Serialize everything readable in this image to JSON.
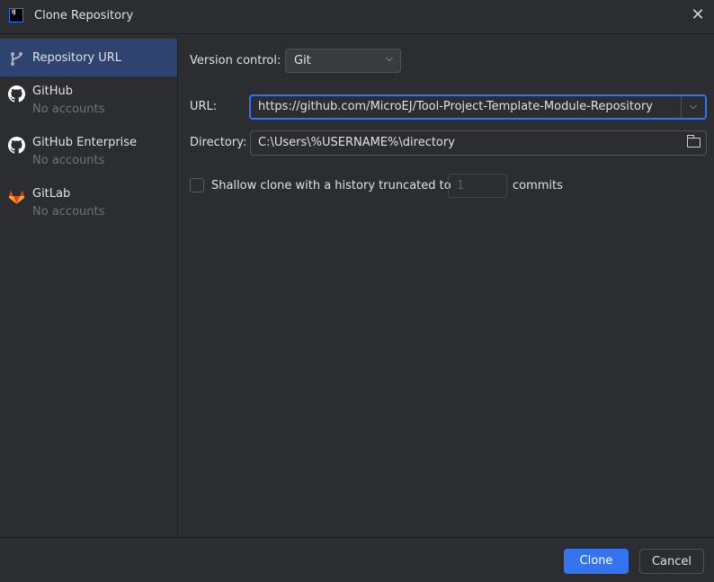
{
  "window": {
    "title": "Clone Repository",
    "app_icon_text": "IJ"
  },
  "sidebar": {
    "items": [
      {
        "label": "Repository URL",
        "icon": "git-branch-icon",
        "selected": true
      },
      {
        "label": "GitHub",
        "sublabel": "No accounts",
        "icon": "github-icon"
      },
      {
        "label": "GitHub Enterprise",
        "sublabel": "No accounts",
        "icon": "github-icon"
      },
      {
        "label": "GitLab",
        "sublabel": "No accounts",
        "icon": "gitlab-icon"
      }
    ]
  },
  "form": {
    "version_control_label": "Version control:",
    "version_control_value": "Git",
    "url_label": "URL:",
    "url_value": "https://github.com/MicroEJ/Tool-Project-Template-Module-Repository",
    "directory_label": "Directory:",
    "directory_value": "C:\\Users\\%USERNAME%\\directory",
    "shallow_label": "Shallow clone with a history truncated to",
    "shallow_checked": false,
    "depth_placeholder": "1",
    "commits_label": "commits"
  },
  "footer": {
    "clone_label": "Clone",
    "cancel_label": "Cancel"
  },
  "colors": {
    "accent": "#3574f0",
    "selection": "#2e436e",
    "background": "#2b2d30"
  }
}
